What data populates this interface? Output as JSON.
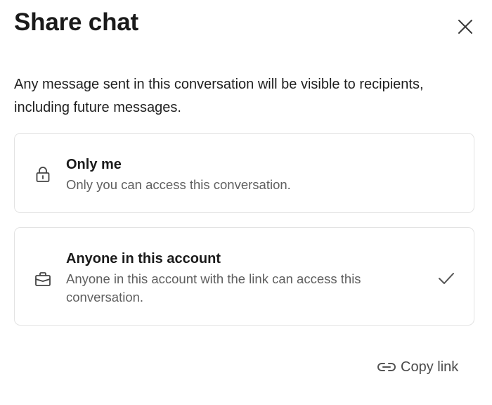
{
  "dialog": {
    "title": "Share chat",
    "close_icon": "close-icon",
    "description": "Any message sent in this conversation will be visible to recipients, including future messages."
  },
  "options": [
    {
      "icon": "lock-icon",
      "title": "Only me",
      "subtitle": "Only you can access this conversation.",
      "selected": false
    },
    {
      "icon": "briefcase-icon",
      "title": "Anyone in this account",
      "subtitle": "Anyone in this account with the link can access this conversation.",
      "selected": true
    }
  ],
  "footer": {
    "copy_link_icon": "link-icon",
    "copy_link_label": "Copy link"
  },
  "colors": {
    "text": "#1a1a1a",
    "secondary_text": "#5f5f5f",
    "border": "#e3e3e3"
  }
}
